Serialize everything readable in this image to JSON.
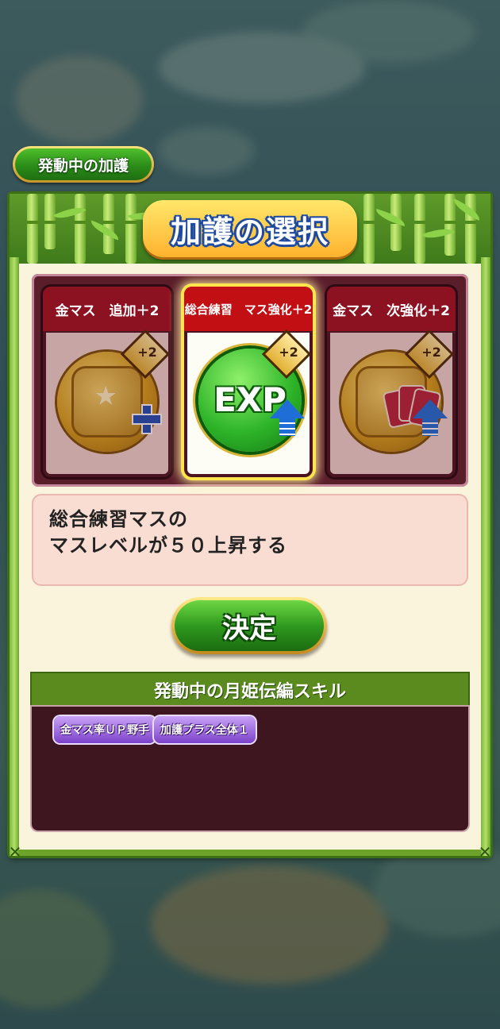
{
  "header": {
    "active_blessing_label": "発動中の加護"
  },
  "dialog": {
    "title": "加護の選択",
    "cards": [
      {
        "label": "金マス　追加＋2",
        "badge": "+2",
        "icon": "gold-star-coin-plus-icon",
        "selected": false
      },
      {
        "label": "総合練習　マス強化＋2",
        "badge": "+2",
        "icon": "exp-coin-up-arrow-icon",
        "coin_text": "EXP",
        "selected": true
      },
      {
        "label": "金マス　次強化＋2",
        "badge": "+2",
        "icon": "gold-cards-coin-up-arrow-icon",
        "selected": false
      }
    ],
    "description": {
      "line1": "総合練習マスの",
      "line2": "マスレベルが５０上昇する"
    },
    "confirm_label": "決定",
    "skills": {
      "heading": "発動中の月姫伝編スキル",
      "chips": [
        "金マス率ＵＰ野手",
        "加護プラス全体１"
      ]
    }
  },
  "colors": {
    "panel_green": "#6ea32b",
    "card_header_red": "#8c1221",
    "selected_glow": "#ffe44c",
    "skill_chip_purple": "#7b42c9"
  }
}
